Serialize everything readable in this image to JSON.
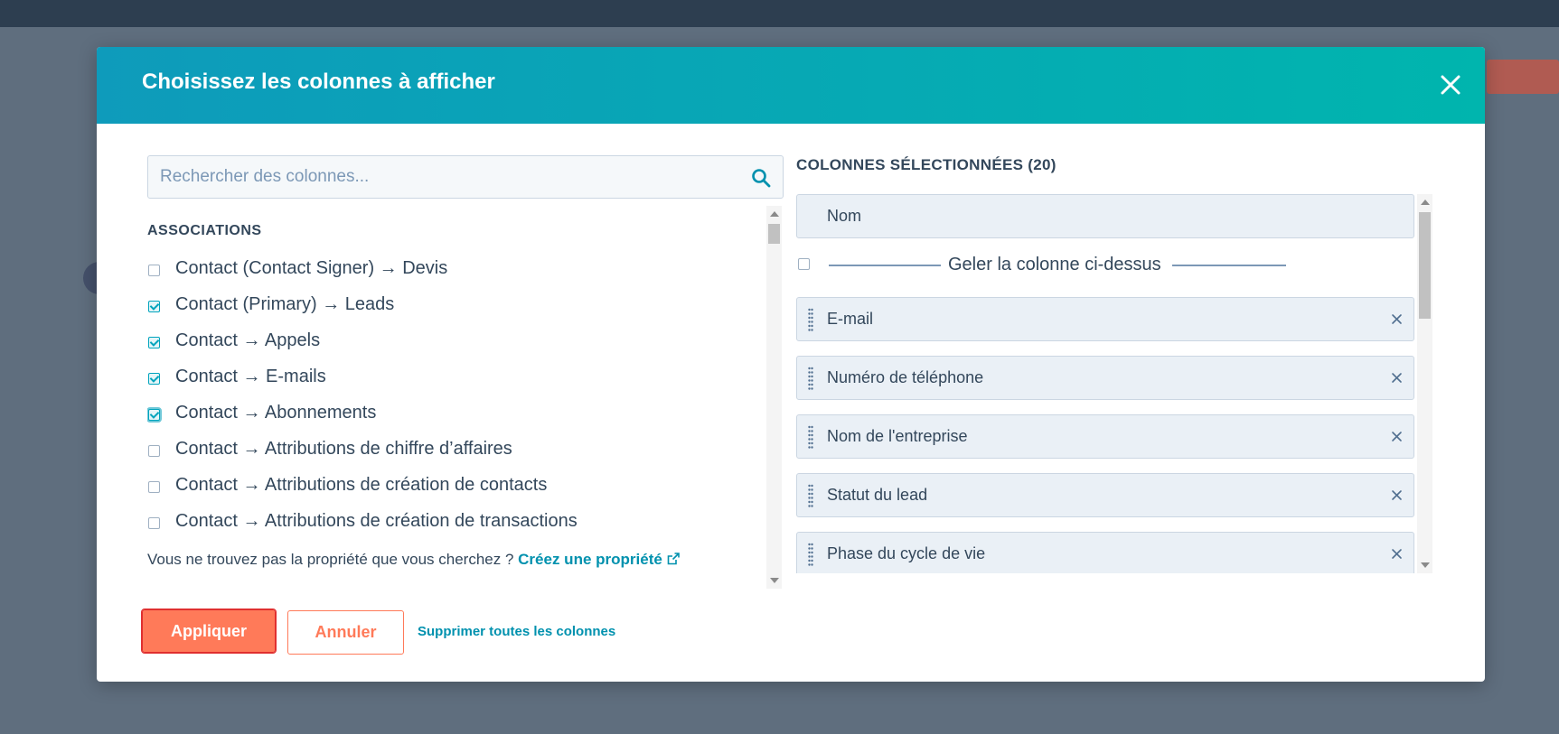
{
  "modal": {
    "title": "Choisissez les colonnes à afficher",
    "close_icon": "close-icon"
  },
  "search": {
    "placeholder": "Rechercher des colonnes...",
    "value": "",
    "icon": "search-icon"
  },
  "associations": {
    "section_title": "ASSOCIATIONS",
    "items": [
      {
        "label": "Contact (Contact Signer) → Devis",
        "checked": false
      },
      {
        "label": "Contact (Primary) → Leads",
        "checked": true
      },
      {
        "label": "Contact → Appels",
        "checked": true
      },
      {
        "label": "Contact → E-mails",
        "checked": true
      },
      {
        "label": "Contact → Abonnements",
        "checked": true
      },
      {
        "label": "Contact → Attributions de chiffre d’affaires",
        "checked": false
      },
      {
        "label": "Contact → Attributions de création de contacts",
        "checked": false
      },
      {
        "label": "Contact → Attributions de création de transactions",
        "checked": false
      }
    ]
  },
  "hint": {
    "text": "Vous ne trouvez pas la propriété que vous cherchez ? ",
    "link_label": "Créez une propriété",
    "link_icon": "external-link-icon"
  },
  "selected": {
    "title": "COLONNES SÉLECTIONNÉES (20)",
    "pinned": "Nom",
    "freeze_label": "Geler la colonne ci-dessus",
    "items": [
      {
        "label": "E-mail"
      },
      {
        "label": "Numéro de téléphone"
      },
      {
        "label": "Nom de l'entreprise"
      },
      {
        "label": "Statut du lead"
      },
      {
        "label": "Phase du cycle de vie"
      }
    ]
  },
  "footer": {
    "apply_label": "Appliquer",
    "cancel_label": "Annuler",
    "remove_all_label": "Supprimer toutes les colonnes"
  },
  "colors": {
    "header_gradient_start": "#0e9bbb",
    "header_gradient_end": "#00b5ae",
    "primary_button": "#ff7a59",
    "link": "#0091ae",
    "checkbox_checked": "#00a4bd",
    "text": "#33475b"
  }
}
